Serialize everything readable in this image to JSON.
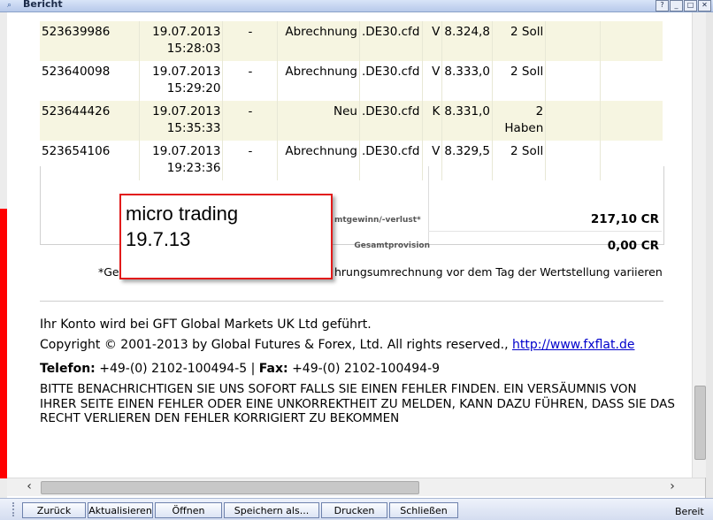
{
  "window": {
    "title": "Bericht"
  },
  "trades": [
    {
      "id": "523639986",
      "date": "19.07.2013",
      "time": "15:28:03",
      "dash": "-",
      "type": "Abrechnung",
      "symbol": ".DE30.cfd",
      "side": "V",
      "price": "8.324,8",
      "qty": "2 Soll"
    },
    {
      "id": "523640098",
      "date": "19.07.2013",
      "time": "15:29:20",
      "dash": "-",
      "type": "Abrechnung",
      "symbol": ".DE30.cfd",
      "side": "V",
      "price": "8.333,0",
      "qty": "2 Soll"
    },
    {
      "id": "523644426",
      "date": "19.07.2013",
      "time": "15:35:33",
      "dash": "-",
      "type": "Neu",
      "symbol": ".DE30.cfd",
      "side": "K",
      "price": "8.331,0",
      "qty": "2 Haben"
    },
    {
      "id": "523654106",
      "date": "19.07.2013",
      "time": "19:23:36",
      "dash": "-",
      "type": "Abrechnung",
      "symbol": ".DE30.cfd",
      "side": "V",
      "price": "8.329,5",
      "qty": "2 Soll"
    }
  ],
  "summary": {
    "label_total_pl": "mtgewinn/-verlust*",
    "value_total_pl": "217,10 CR",
    "label_commission": "Gesamtprovision",
    "value_commission": "0,00 CR"
  },
  "footnote": {
    "prefix": "*Ge",
    "suffix": "hrungsumrechnung vor dem Tag der Wertstellung variieren"
  },
  "footer": {
    "account_line": "Ihr Konto wird bei GFT Global Markets UK Ltd geführt.",
    "copyright": "Copyright © 2001-2013 by Global Futures & Forex, Ltd. All rights reserved., ",
    "link": "http://www.fxflat.de",
    "phone_label": "Telefon:",
    "phone": " +49-(0) 2102-100494-5 | ",
    "fax_label": "Fax:",
    "fax": " +49-(0) 2102-100494-9",
    "warning": "BITTE BENACHRICHTIGEN SIE UNS SOFORT FALLS SIE EINEN FEHLER FINDEN. EIN VERSÄUMNIS VON IHRER SEITE EINEN FEHLER ODER EINE UNKORREKTHEIT ZU MELDEN, KANN DAZU FÜHREN, DASS SIE DAS RECHT VERLIEREN DEN FEHLER KORRIGIERT ZU BEKOMMEN"
  },
  "annotation": {
    "line1": "micro trading",
    "line2": "19.7.13",
    "border_color": "#e21b1b"
  },
  "toolbar": {
    "back": "Zurück",
    "refresh": "Aktualisieren",
    "open": "Öffnen",
    "save_as": "Speichern als...",
    "print": "Drucken",
    "close": "Schließen",
    "status": "Bereit"
  },
  "colors": {
    "row_alt": "#f6f5e1",
    "left_strip": "#ff0000",
    "link": "#0000cc"
  }
}
